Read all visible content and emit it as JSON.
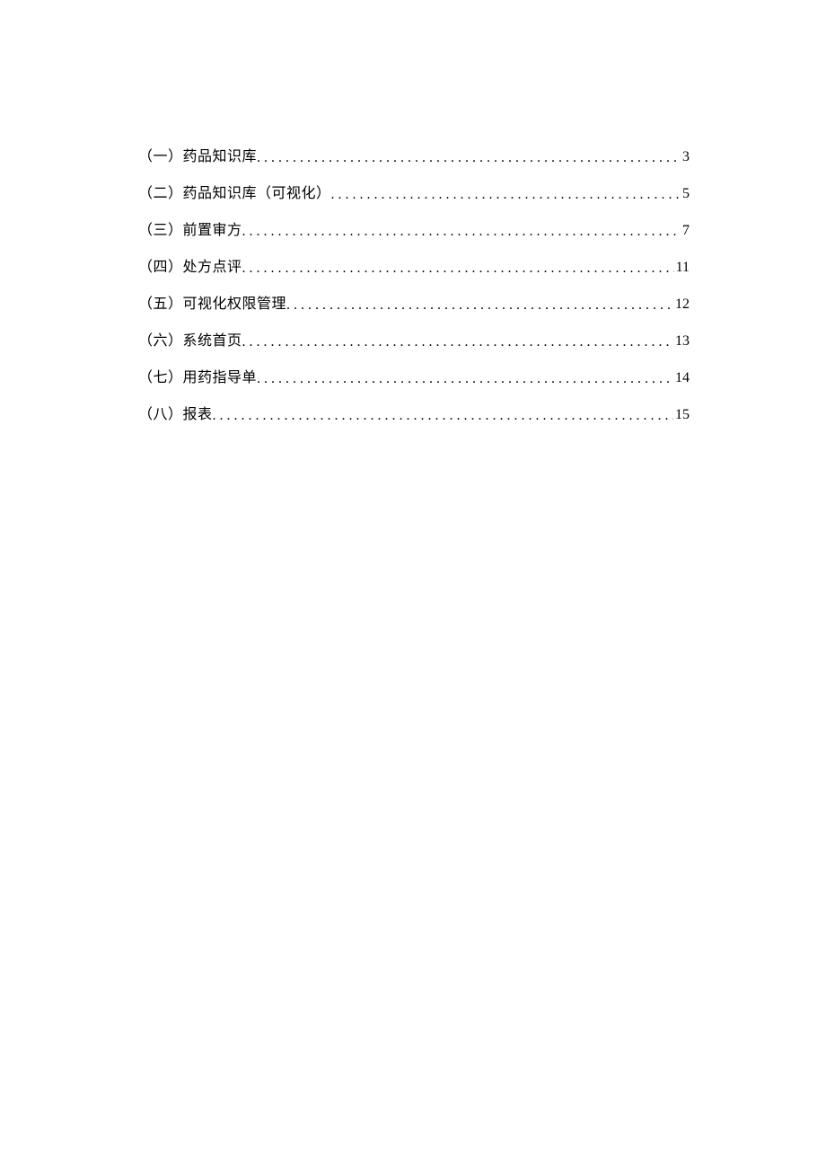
{
  "toc": {
    "entries": [
      {
        "label": "（一）药品知识库",
        "page": "3"
      },
      {
        "label": "（二）药品知识库（可视化）",
        "page": "5"
      },
      {
        "label": "（三）前置审方",
        "page": "7"
      },
      {
        "label": "（四）处方点评",
        "page": "11"
      },
      {
        "label": "（五）可视化权限管理",
        "page": "12"
      },
      {
        "label": "（六）系统首页",
        "page": "13"
      },
      {
        "label": "（七）用药指导单",
        "page": "14"
      },
      {
        "label": "（八）报表",
        "page": "15"
      }
    ]
  }
}
